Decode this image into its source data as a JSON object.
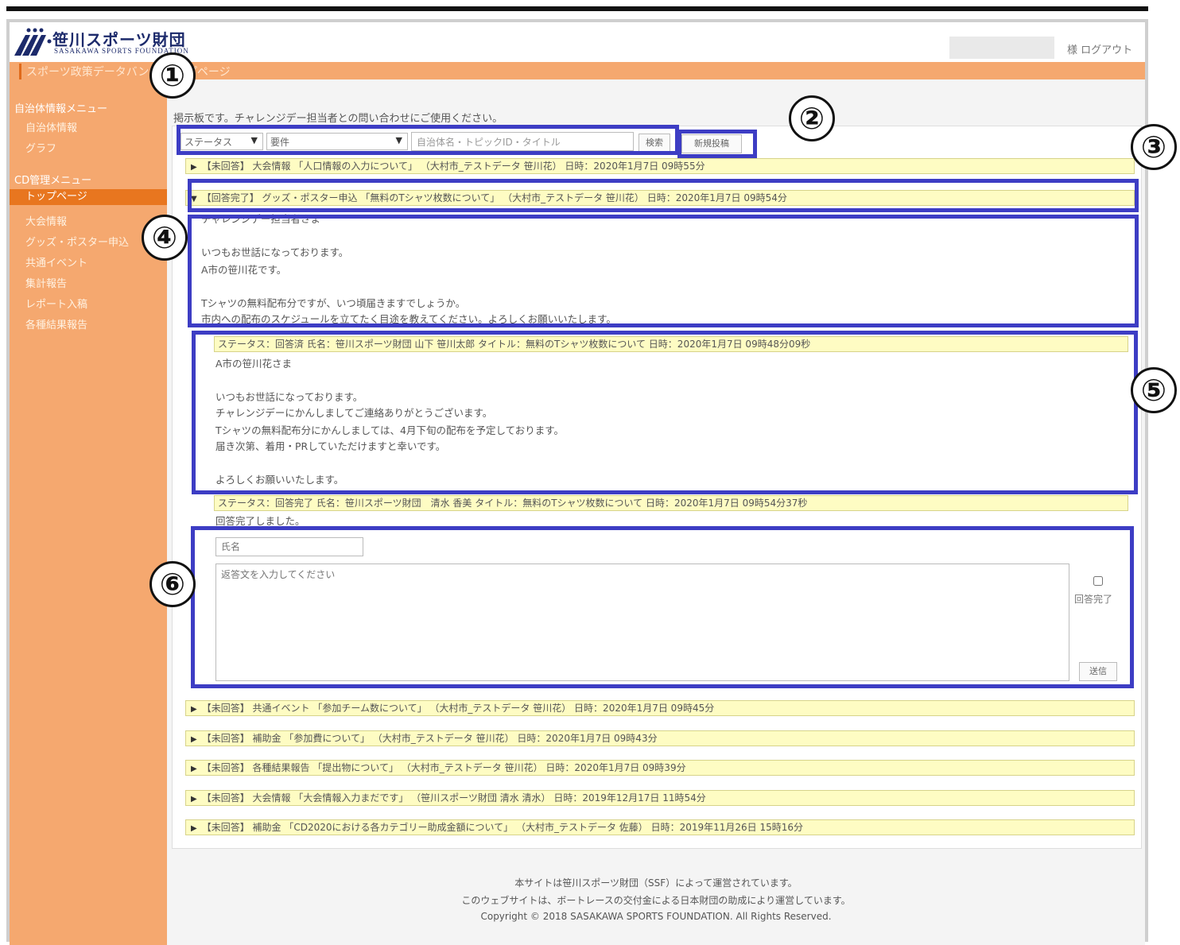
{
  "header": {
    "logo_title": "笹川スポーツ財団",
    "logo_subtitle": "SASAKAWA SPORTS FOUNDATION",
    "logout": "様 ログアウト",
    "breadcrumb": "スポーツ政策データバンク トップページ"
  },
  "sidebar": {
    "menu1_title": "自治体情報メニュー",
    "menu1_items": [
      "自治体情報",
      "グラフ"
    ],
    "menu2_title": "CD管理メニュー",
    "menu2_items": [
      "トップページ",
      "大会情報",
      "グッズ・ポスター申込",
      "共通イベント",
      "集計報告",
      "レポート入稿",
      "各種結果報告"
    ]
  },
  "main": {
    "intro": "掲示板です。チャレンジデー担当者との問い合わせにご使用ください。",
    "filter_status": "ステータス",
    "filter_subject": "要件",
    "search_placeholder": "自治体名・トピックID・タイトル",
    "search_button": "検索",
    "new_post_button": "新規投稿"
  },
  "threads_top": [
    "【未回答】 大会情報 「人口情報の入力について」 （大村市_テストデータ 笹川花） 日時：2020年1月7日 09時55分"
  ],
  "open_thread": {
    "header": "【回答完了】 グッズ・ポスター申込 「無料のTシャツ枚数について」 （大村市_テストデータ 笹川花） 日時：2020年1月7日 09時54分",
    "body": [
      "チャレンジデー担当者さま",
      "",
      "いつもお世話になっております。",
      "A市の笹川花です。",
      "",
      "Tシャツの無料配布分ですが、いつ頃届きますでしょうか。",
      "市内への配布のスケジュールを立てたく目途を教えてください。よろしくお願いいたします。"
    ],
    "reply1_header": "ステータス：回答済 氏名：笹川スポーツ財団 山下 笹川太郎 タイトル：無料のTシャツ枚数について 日時：2020年1月7日 09時48分09秒",
    "reply1_body": [
      "A市の笹川花さま",
      "",
      "いつもお世話になっております。",
      "チャレンジデーにかんしましてご連絡ありがとうございます。",
      "Tシャツの無料配布分にかんしましては、4月下旬の配布を予定しております。",
      "届き次第、着用・PRしていただけますと幸いです。",
      "",
      "よろしくお願いいたします。"
    ],
    "reply2_header": "ステータス：回答完了 氏名：笹川スポーツ財団　清水 香美 タイトル：無料のTシャツ枚数について 日時：2020年1月7日 09時54分37秒",
    "reply2_body": "回答完了しました。",
    "form_name_placeholder": "氏名",
    "form_text_placeholder": "返答文を入力してください",
    "form_complete_label": "回答完了",
    "form_send_button": "送信"
  },
  "threads_bottom": [
    "【未回答】 共通イベント 「参加チーム数について」 （大村市_テストデータ 笹川花） 日時：2020年1月7日 09時45分",
    "【未回答】 補助金 「参加費について」 （大村市_テストデータ 笹川花） 日時：2020年1月7日 09時43分",
    "【未回答】 各種結果報告 「提出物について」 （大村市_テストデータ 笹川花） 日時：2020年1月7日 09時39分",
    "【未回答】 大会情報 「大会情報入力まだです」 （笹川スポーツ財団 清水 清水） 日時：2019年12月17日 11時54分",
    "【未回答】 補助金 「CD2020における各カテゴリー助成金額について」 （大村市_テストデータ 佐藤） 日時：2019年11月26日 15時16分"
  ],
  "footer": [
    "本サイトは笹川スポーツ財団（SSF）によって運営されています。",
    "このウェブサイトは、ボートレースの交付金による日本財団の助成により運営しています。",
    "Copyright © 2018 SASAKAWA SPORTS FOUNDATION. All Rights Reserved."
  ],
  "callouts": [
    "①",
    "②",
    "③",
    "④",
    "⑤",
    "⑥"
  ],
  "colors": {
    "sidebar": "#f5a86f",
    "active": "#e8761f",
    "row": "#fefcc3",
    "callout_box": "#3d3dc4"
  }
}
